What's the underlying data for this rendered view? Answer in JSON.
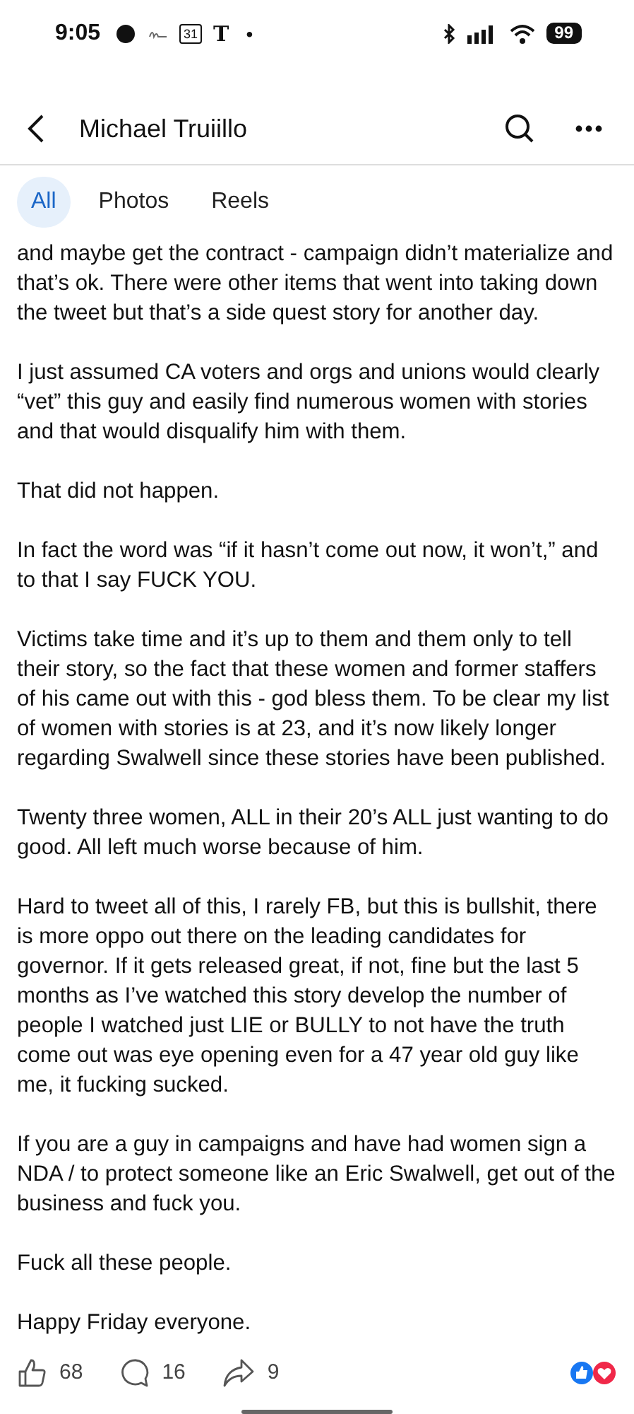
{
  "status_bar": {
    "time": "9:05",
    "calendar_day": "31",
    "news_letter": "T",
    "more_dot": "•",
    "battery": "99"
  },
  "header": {
    "title": "Michael Truiillo"
  },
  "tabs": [
    {
      "label": "All",
      "selected": true
    },
    {
      "label": "Photos",
      "selected": false
    },
    {
      "label": "Reels",
      "selected": false
    }
  ],
  "post": {
    "paragraphs": [
      "and maybe get the contract - campaign didn’t materialize and that’s ok.  There were other items that went into taking down the tweet but that’s a side quest story for another day.",
      "I just assumed CA voters and orgs and unions would clearly “vet” this guy and easily find numerous women with stories and that would disqualify him with them.",
      "That did not happen.",
      "In fact the word was  “if it hasn’t come out now, it won’t,” and to that I say FUCK YOU.",
      "Victims take time and it’s up to them and them only to tell their story, so the fact that these women and former staffers of his came out with this - god bless them.   To be clear my list of women with stories is at 23, and it’s now likely longer regarding Swalwell since these stories have been published.",
      "Twenty three women, ALL in their 20’s ALL just wanting to do good.  All left much worse because of him.",
      "Hard to tweet all of this, I rarely FB, but this is bullshit, there is more oppo out there on the leading candidates for governor.   If it gets released great, if not, fine but the last 5 months as I’ve watched this story develop the number of people I watched just LIE or BULLY to not have the truth come out was eye opening even for a 47 year old guy like me, it fucking sucked.",
      "If you are a guy in campaigns and have had women sign a NDA / to protect someone like an Eric Swalwell, get out of the business and fuck you.",
      "Fuck all these people.",
      "Happy Friday everyone."
    ],
    "likes": "68",
    "comments": "16",
    "shares": "9"
  }
}
